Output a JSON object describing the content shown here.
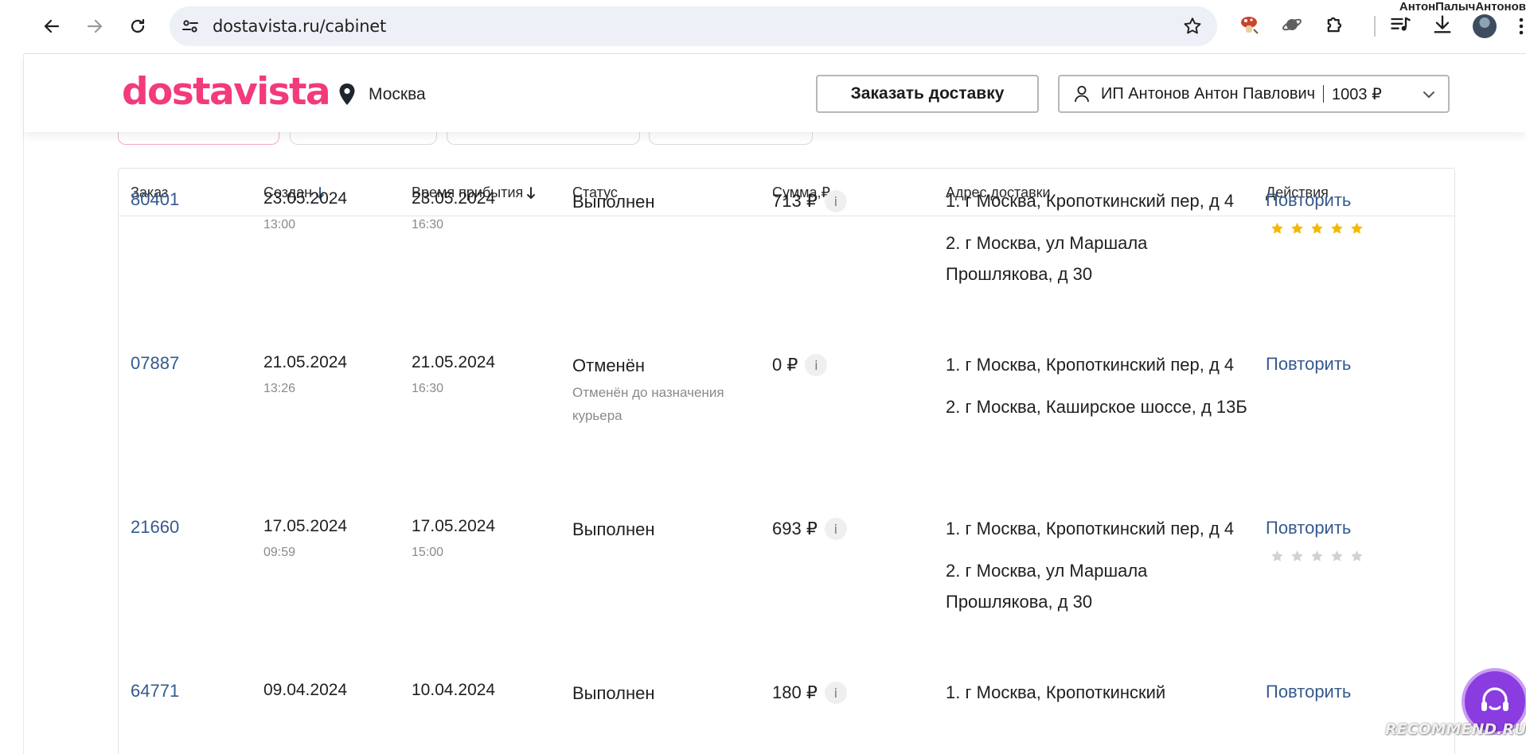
{
  "browser": {
    "url": "dostavista.ru/cabinet",
    "profile_name": "АнтонПалычАнтонов"
  },
  "header": {
    "logo": "dostavista",
    "city": "Москва",
    "order_button": "Заказать доставку",
    "account_name": "ИП Антонов Антон Павлович",
    "balance": "1003 ₽"
  },
  "table": {
    "columns": {
      "order": "Заказ",
      "created": "Создан",
      "arrival": "Время прибытия",
      "status": "Статус",
      "sum": "Сумма,₽",
      "address": "Адрес доставки",
      "actions": "Действия"
    },
    "rows": [
      {
        "id": "80401",
        "created_date": "23.05.2024",
        "created_time": "13:00",
        "arrival_date": "23.05.2024",
        "arrival_time": "16:30",
        "status": "Выполнен",
        "status_note": "",
        "sum": "713 ₽",
        "addresses": [
          "1. г Москва, Кропоткинский пер, д 4",
          "2. г Москва, ул Маршала Прошлякова, д 30"
        ],
        "action": "Повторить",
        "rating": 5,
        "rating_max": 5
      },
      {
        "id": "07887",
        "created_date": "21.05.2024",
        "created_time": "13:26",
        "arrival_date": "21.05.2024",
        "arrival_time": "16:30",
        "status": "Отменён",
        "status_note": "Отменён до назначения курьера",
        "sum": "0 ₽",
        "addresses": [
          "1. г Москва, Кропоткинский пер, д 4",
          "2. г Москва, Каширское шоссе, д 13Б"
        ],
        "action": "Повторить"
      },
      {
        "id": "21660",
        "created_date": "17.05.2024",
        "created_time": "09:59",
        "arrival_date": "17.05.2024",
        "arrival_time": "15:00",
        "status": "Выполнен",
        "status_note": "",
        "sum": "693 ₽",
        "addresses": [
          "1. г Москва, Кропоткинский пер, д 4",
          "2. г Москва, ул Маршала Прошлякова, д 30"
        ],
        "action": "Повторить",
        "rating": 0,
        "rating_max": 5
      },
      {
        "id": "64771",
        "created_date": "09.04.2024",
        "created_time": "",
        "arrival_date": "10.04.2024",
        "arrival_time": "",
        "status": "Выполнен",
        "status_note": "",
        "sum": "180 ₽",
        "addresses": [
          "1. г Москва, Кропоткинский"
        ],
        "action": "Повторить"
      }
    ]
  },
  "watermark": "RECOMMEND.RU",
  "colors": {
    "brand": "#f23a7c",
    "link": "#355a8e",
    "star_filled": "#f5b800",
    "star_empty": "#d2d2d2",
    "chat": "#8b3ce0"
  }
}
